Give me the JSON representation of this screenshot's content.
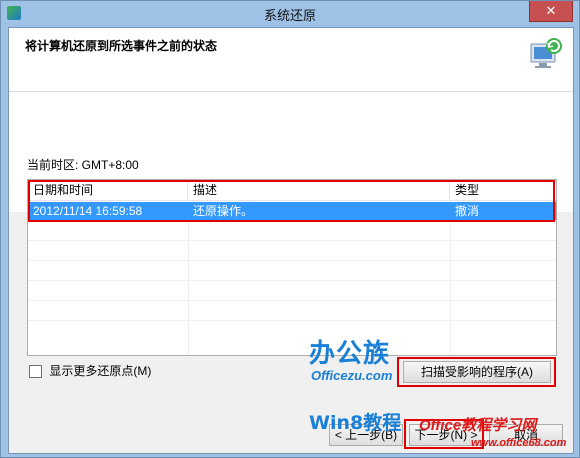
{
  "window": {
    "title": "系统还原",
    "close_label": "✕"
  },
  "header": {
    "title": "将计算机还原到所选事件之前的状态",
    "icon": "system-restore-icon"
  },
  "timezone": {
    "label": "当前时区: GMT+8:00"
  },
  "table": {
    "columns": [
      "日期和时间",
      "描述",
      "类型"
    ],
    "rows": [
      {
        "datetime": "2012/11/14 16:59:58",
        "description": "还原操作。",
        "type": "撤消",
        "selected": true
      }
    ]
  },
  "options": {
    "show_more_label": "显示更多还原点(M)",
    "show_more_checked": false
  },
  "buttons": {
    "scan": "扫描受影响的程序(A)",
    "back": "< 上一步(B)",
    "next": "下一步(N) >",
    "cancel": "取消"
  },
  "watermark": {
    "ban": "办公族",
    "officezu": "Officezu.com",
    "win8": "Win8教程",
    "site": "Office教程学习网",
    "url": "www.office68.com"
  },
  "colors": {
    "selection": "#3399ff",
    "highlight_box": "#e00000",
    "window_frame": "#9ec2e6"
  }
}
